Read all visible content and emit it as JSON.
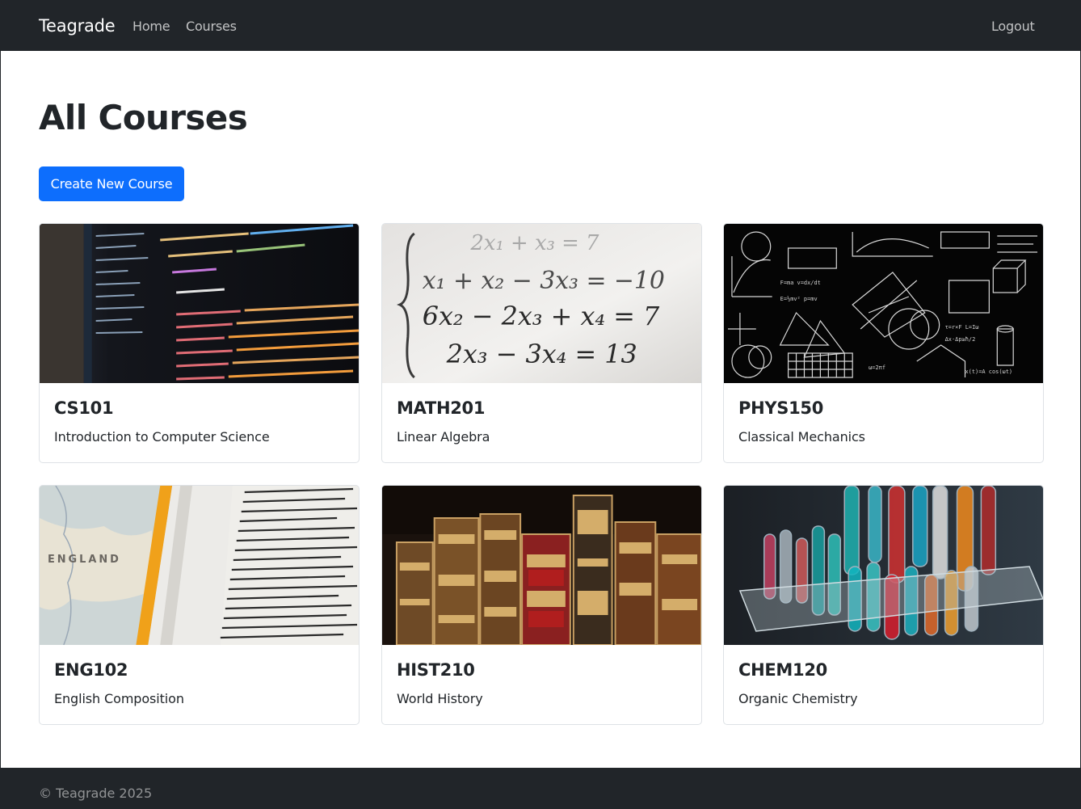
{
  "navbar": {
    "brand": "Teagrade",
    "links": [
      "Home",
      "Courses"
    ],
    "logout": "Logout"
  },
  "main": {
    "title": "All Courses",
    "create_button": "Create New Course",
    "courses": [
      {
        "code": "CS101",
        "name": "Introduction to Computer Science",
        "image": "code-editor-photo"
      },
      {
        "code": "MATH201",
        "name": "Linear Algebra",
        "image": "equations-photo"
      },
      {
        "code": "PHYS150",
        "name": "Classical Mechanics",
        "image": "blackboard-diagrams-photo"
      },
      {
        "code": "ENG102",
        "name": "English Composition",
        "image": "dictionary-map-photo"
      },
      {
        "code": "HIST210",
        "name": "World History",
        "image": "antique-books-photo"
      },
      {
        "code": "CHEM120",
        "name": "Organic Chemistry",
        "image": "test-tubes-photo"
      }
    ]
  },
  "footer": {
    "text": "© Teagrade 2025"
  },
  "colors": {
    "navbar_bg": "#212529",
    "primary": "#0d6efd",
    "card_border": "#dee2e6"
  }
}
